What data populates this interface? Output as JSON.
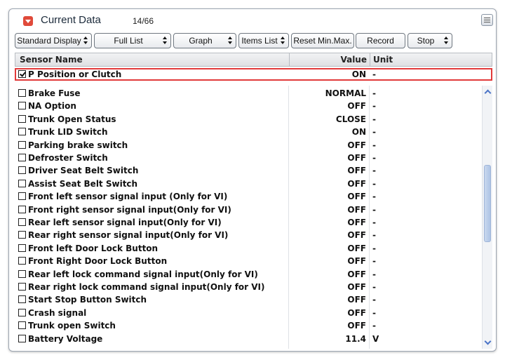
{
  "panel": {
    "title": "Current Data",
    "counter": "14/66"
  },
  "toolbar": {
    "standard_display": "Standard Display",
    "full_list": "Full List",
    "graph": "Graph",
    "items_list": "Items List",
    "reset_min_max": "Reset Min.Max.",
    "record": "Record",
    "stop": "Stop"
  },
  "columns": {
    "sensor_name": "Sensor Name",
    "value": "Value",
    "unit": "Unit"
  },
  "pinned": [
    {
      "name": "P Position or Clutch",
      "value": "ON",
      "unit": "-",
      "checked": true
    }
  ],
  "rows": [
    {
      "name": "Brake Fuse",
      "value": "NORMAL",
      "unit": "-"
    },
    {
      "name": "NA Option",
      "value": "OFF",
      "unit": "-"
    },
    {
      "name": "Trunk Open Status",
      "value": "CLOSE",
      "unit": "-"
    },
    {
      "name": "Trunk LID Switch",
      "value": "ON",
      "unit": "-"
    },
    {
      "name": "Parking brake switch",
      "value": "OFF",
      "unit": "-"
    },
    {
      "name": "Defroster Switch",
      "value": "OFF",
      "unit": "-"
    },
    {
      "name": "Driver Seat Belt Switch",
      "value": "OFF",
      "unit": "-"
    },
    {
      "name": "Assist Seat Belt Switch",
      "value": "OFF",
      "unit": "-"
    },
    {
      "name": "Front left sensor signal input (Only for VI)",
      "value": "OFF",
      "unit": "-"
    },
    {
      "name": "Front right sensor signal input(Only for VI)",
      "value": "OFF",
      "unit": "-"
    },
    {
      "name": "Rear  left sensor signal input(Only for VI)",
      "value": "OFF",
      "unit": "-"
    },
    {
      "name": "Rear right sensor signal input(Only for VI)",
      "value": "OFF",
      "unit": "-"
    },
    {
      "name": "Front left Door Lock Button",
      "value": "OFF",
      "unit": "-"
    },
    {
      "name": "Front Right Door Lock Button",
      "value": "OFF",
      "unit": "-"
    },
    {
      "name": "Rear left lock command signal input(Only for VI)",
      "value": "OFF",
      "unit": "-"
    },
    {
      "name": "Rear right lock command signal input(Only for VI)",
      "value": "OFF",
      "unit": "-"
    },
    {
      "name": "Start Stop Button Switch",
      "value": "OFF",
      "unit": "-"
    },
    {
      "name": "Crash signal",
      "value": "OFF",
      "unit": "-"
    },
    {
      "name": "Trunk open Switch",
      "value": "OFF",
      "unit": "-"
    },
    {
      "name": "Battery Voltage",
      "value": "11.4",
      "unit": "V"
    }
  ],
  "colors": {
    "accent_red": "#e23a3a",
    "scroll_blue": "#aec4e6"
  }
}
